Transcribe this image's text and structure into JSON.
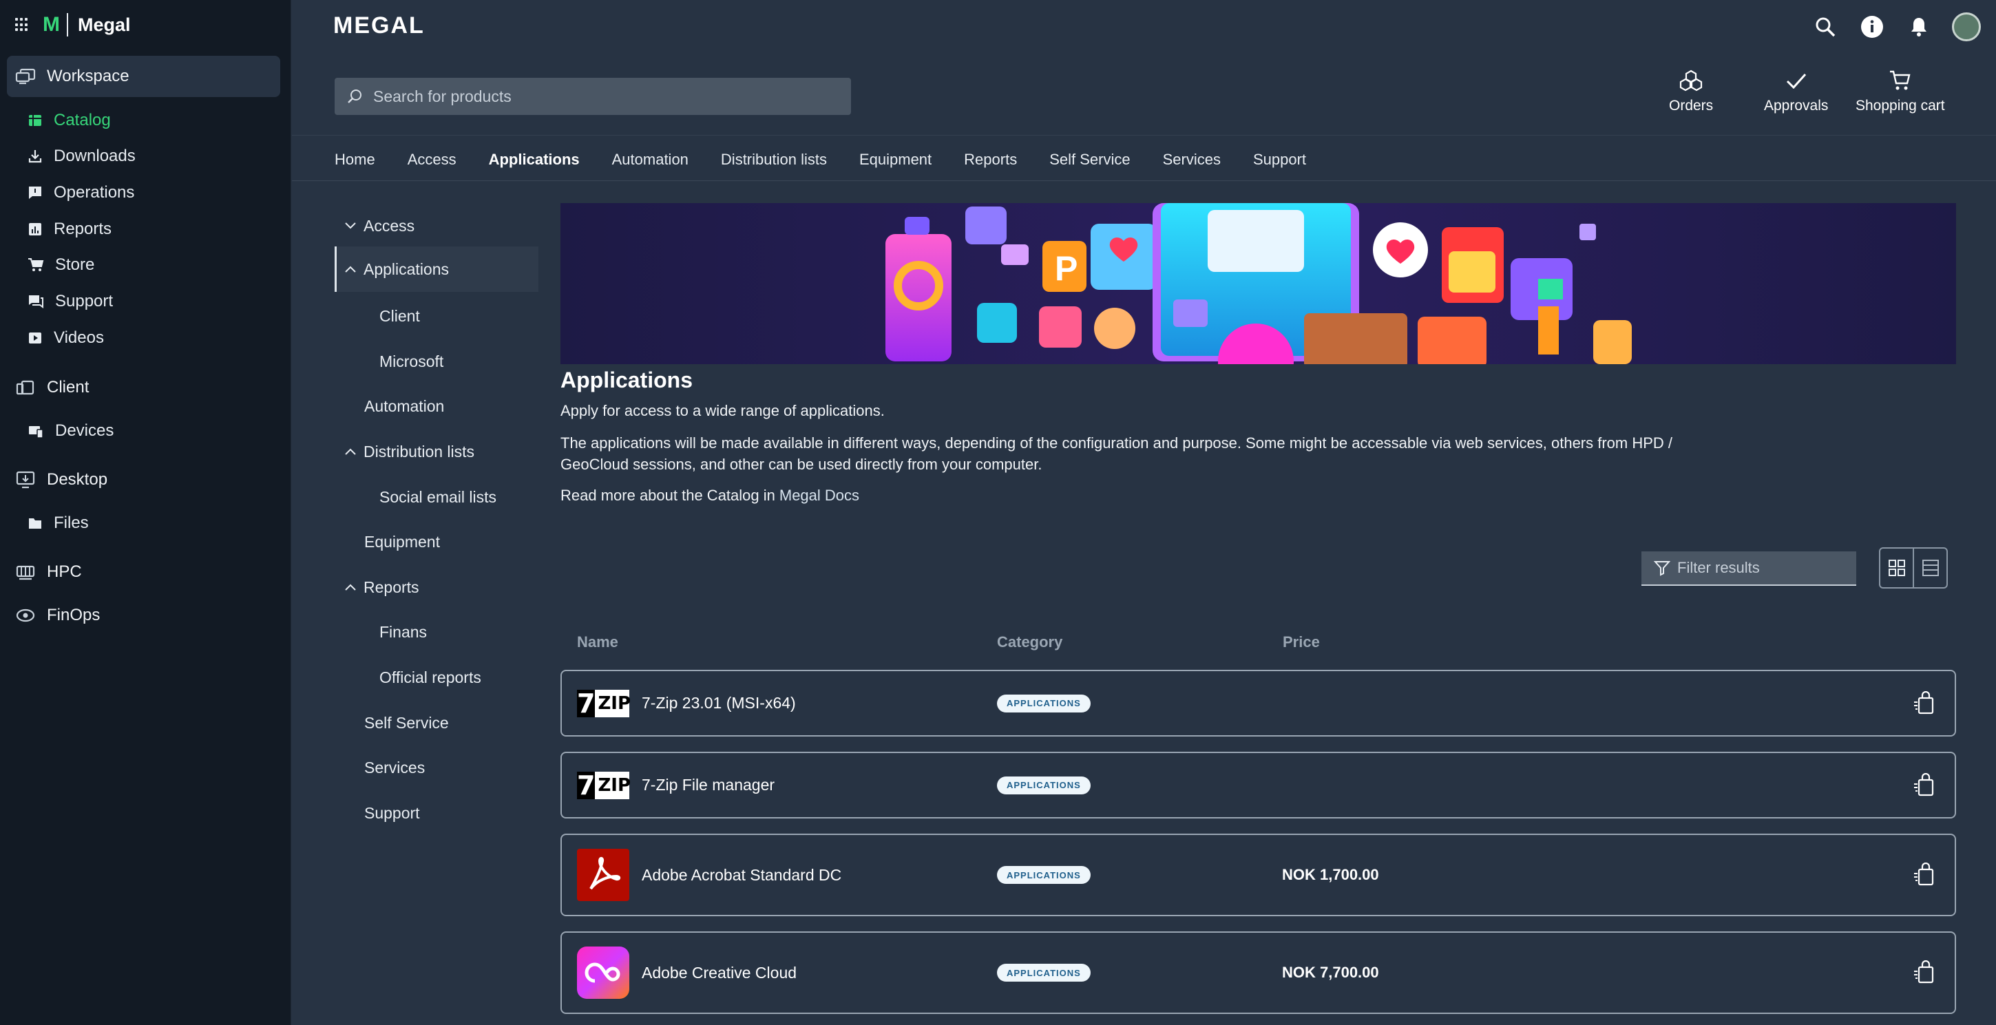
{
  "brand": {
    "letter": "M",
    "name": "Megal",
    "logo": "MEGAL"
  },
  "leftnav": {
    "workspace": "Workspace",
    "catalog": "Catalog",
    "downloads": "Downloads",
    "operations": "Operations",
    "reports": "Reports",
    "store": "Store",
    "support": "Support",
    "videos": "Videos",
    "client": "Client",
    "devices": "Devices",
    "desktop": "Desktop",
    "files": "Files",
    "hpc": "HPC",
    "finops": "FinOps"
  },
  "search": {
    "placeholder": "Search for products"
  },
  "quick": {
    "orders": "Orders",
    "approvals": "Approvals",
    "cart": "Shopping cart"
  },
  "tabs": [
    "Home",
    "Access",
    "Applications",
    "Automation",
    "Distribution lists",
    "Equipment",
    "Reports",
    "Self Service",
    "Services",
    "Support"
  ],
  "tree": {
    "access": "Access",
    "applications": "Applications",
    "client": "Client",
    "microsoft": "Microsoft",
    "automation": "Automation",
    "distribution": "Distribution lists",
    "social": "Social email lists",
    "equipment": "Equipment",
    "reports": "Reports",
    "finans": "Finans",
    "official": "Official reports",
    "selfservice": "Self Service",
    "services": "Services",
    "support": "Support"
  },
  "content": {
    "title": "Applications",
    "intro": "Apply for access to a wide range of applications.",
    "desc": "The applications will be made available in different ways, depending of the configuration and purpose. Some might be accessable via web services, others from HPD / GeoCloud sessions, and other can be used directly from your computer.",
    "readmore": "Read more about the Catalog in",
    "readmore_link": "Megal Docs",
    "filter_placeholder": "Filter results"
  },
  "table": {
    "headers": {
      "name": "Name",
      "category": "Category",
      "price": "Price"
    },
    "rows": [
      {
        "name": "7-Zip 23.01 (MSI-x64)",
        "category": "APPLICATIONS",
        "price": ""
      },
      {
        "name": "7-Zip File manager",
        "category": "APPLICATIONS",
        "price": ""
      },
      {
        "name": "Adobe Acrobat Standard DC",
        "category": "APPLICATIONS",
        "price": "NOK 1,700.00"
      },
      {
        "name": "Adobe Creative Cloud",
        "category": "APPLICATIONS",
        "price": "NOK 7,700.00"
      }
    ]
  },
  "colors": {
    "accent": "#37d67a",
    "sidebar": "#121a24",
    "background": "#273343"
  }
}
